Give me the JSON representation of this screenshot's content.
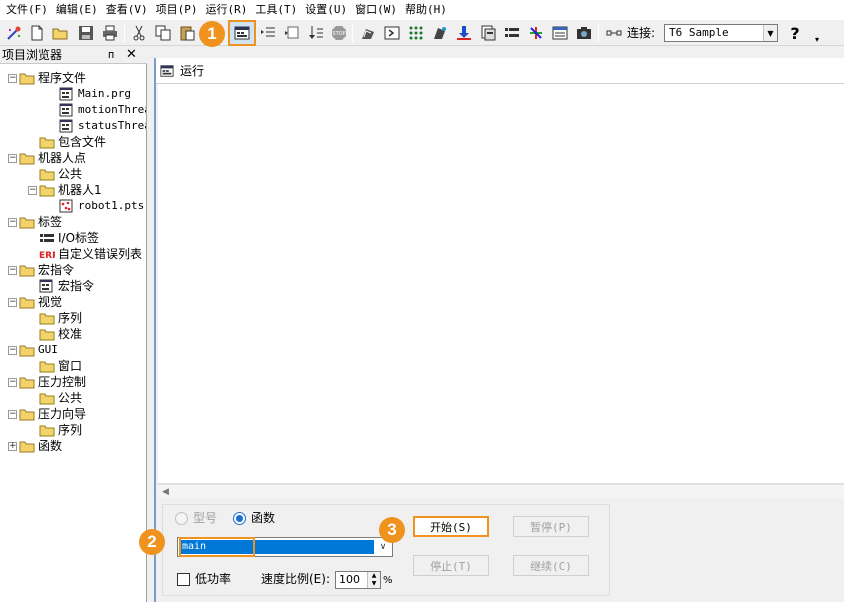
{
  "menubar": {
    "items": [
      "文件(F)",
      "编辑(E)",
      "查看(V)",
      "项目(P)",
      "运行(R)",
      "工具(T)",
      "设置(U)",
      "窗口(W)",
      "帮助(H)"
    ]
  },
  "toolbar": {
    "connect_label": "连接:",
    "connection_value": "T6 Sample",
    "help_label": "?",
    "icons": [
      "wizard-icon",
      "new-file-icon",
      "open-folder-icon",
      "save-icon",
      "print-icon",
      "cut-icon",
      "copy-icon",
      "paste-icon",
      "run-window-icon",
      "indent-icon",
      "outdent-icon",
      "step-icon",
      "stop-icon",
      "robot-manager-icon",
      "command-window-icon",
      "io-monitor-icon",
      "jog-icon",
      "download-icon",
      "build-icon",
      "io-label-icon",
      "robot-points-icon",
      "task-manager-icon",
      "camera-icon",
      "connect-icon",
      "help-icon"
    ],
    "accent_color": "#f0921e"
  },
  "explorer": {
    "title": "项目浏览器",
    "pin": "ᴨ",
    "close": "✕",
    "tree": [
      {
        "label": "程序文件",
        "icon": "folder-icon",
        "mono": false
      },
      {
        "label": "Main.prg",
        "icon": "program-file-icon",
        "mono": true
      },
      {
        "label": "motionThread.p",
        "icon": "program-file-icon",
        "mono": true
      },
      {
        "label": "statusThread.p",
        "icon": "program-file-icon",
        "mono": true
      },
      {
        "label": "包含文件",
        "icon": "folder-icon",
        "mono": false
      },
      {
        "label": "机器人点",
        "icon": "folder-icon",
        "mono": false
      },
      {
        "label": "公共",
        "icon": "folder-icon",
        "mono": false
      },
      {
        "label": "机器人1",
        "icon": "folder-icon",
        "mono": false
      },
      {
        "label": "robot1.pts",
        "icon": "points-file-icon",
        "mono": true
      },
      {
        "label": "标签",
        "icon": "folder-icon",
        "mono": false
      },
      {
        "label": "I/O标签",
        "icon": "io-label-icon",
        "mono": false
      },
      {
        "label": "自定义错误列表",
        "icon": "error-icon",
        "mono": false
      },
      {
        "label": "宏指令",
        "icon": "folder-icon",
        "mono": false
      },
      {
        "label": "宏指令",
        "icon": "program-file-icon",
        "mono": false
      },
      {
        "label": "视觉",
        "icon": "folder-icon",
        "mono": false
      },
      {
        "label": "序列",
        "icon": "folder-icon",
        "mono": false
      },
      {
        "label": "校准",
        "icon": "folder-icon",
        "mono": false
      },
      {
        "label": "GUI",
        "icon": "folder-icon",
        "mono": true
      },
      {
        "label": "窗口",
        "icon": "folder-icon",
        "mono": false
      },
      {
        "label": "压力控制",
        "icon": "folder-icon",
        "mono": false
      },
      {
        "label": "公共",
        "icon": "folder-icon",
        "mono": false
      },
      {
        "label": "压力向导",
        "icon": "folder-icon",
        "mono": false
      },
      {
        "label": "序列",
        "icon": "folder-icon",
        "mono": false
      },
      {
        "label": "函数",
        "icon": "folder-icon",
        "mono": false
      }
    ]
  },
  "run_window": {
    "title": "运行",
    "mode_model": "型号",
    "mode_function": "函数",
    "function_value": "main",
    "low_power_label": "低功率",
    "speed_label": "速度比例(E):",
    "speed_value": "100",
    "speed_unit": "%",
    "start_button": "开始(S)",
    "pause_button": "暂停(P)",
    "stop_button": "停止(T)",
    "continue_button": "继续(C)"
  },
  "callouts": {
    "one": "1",
    "two": "2",
    "three": "3"
  }
}
